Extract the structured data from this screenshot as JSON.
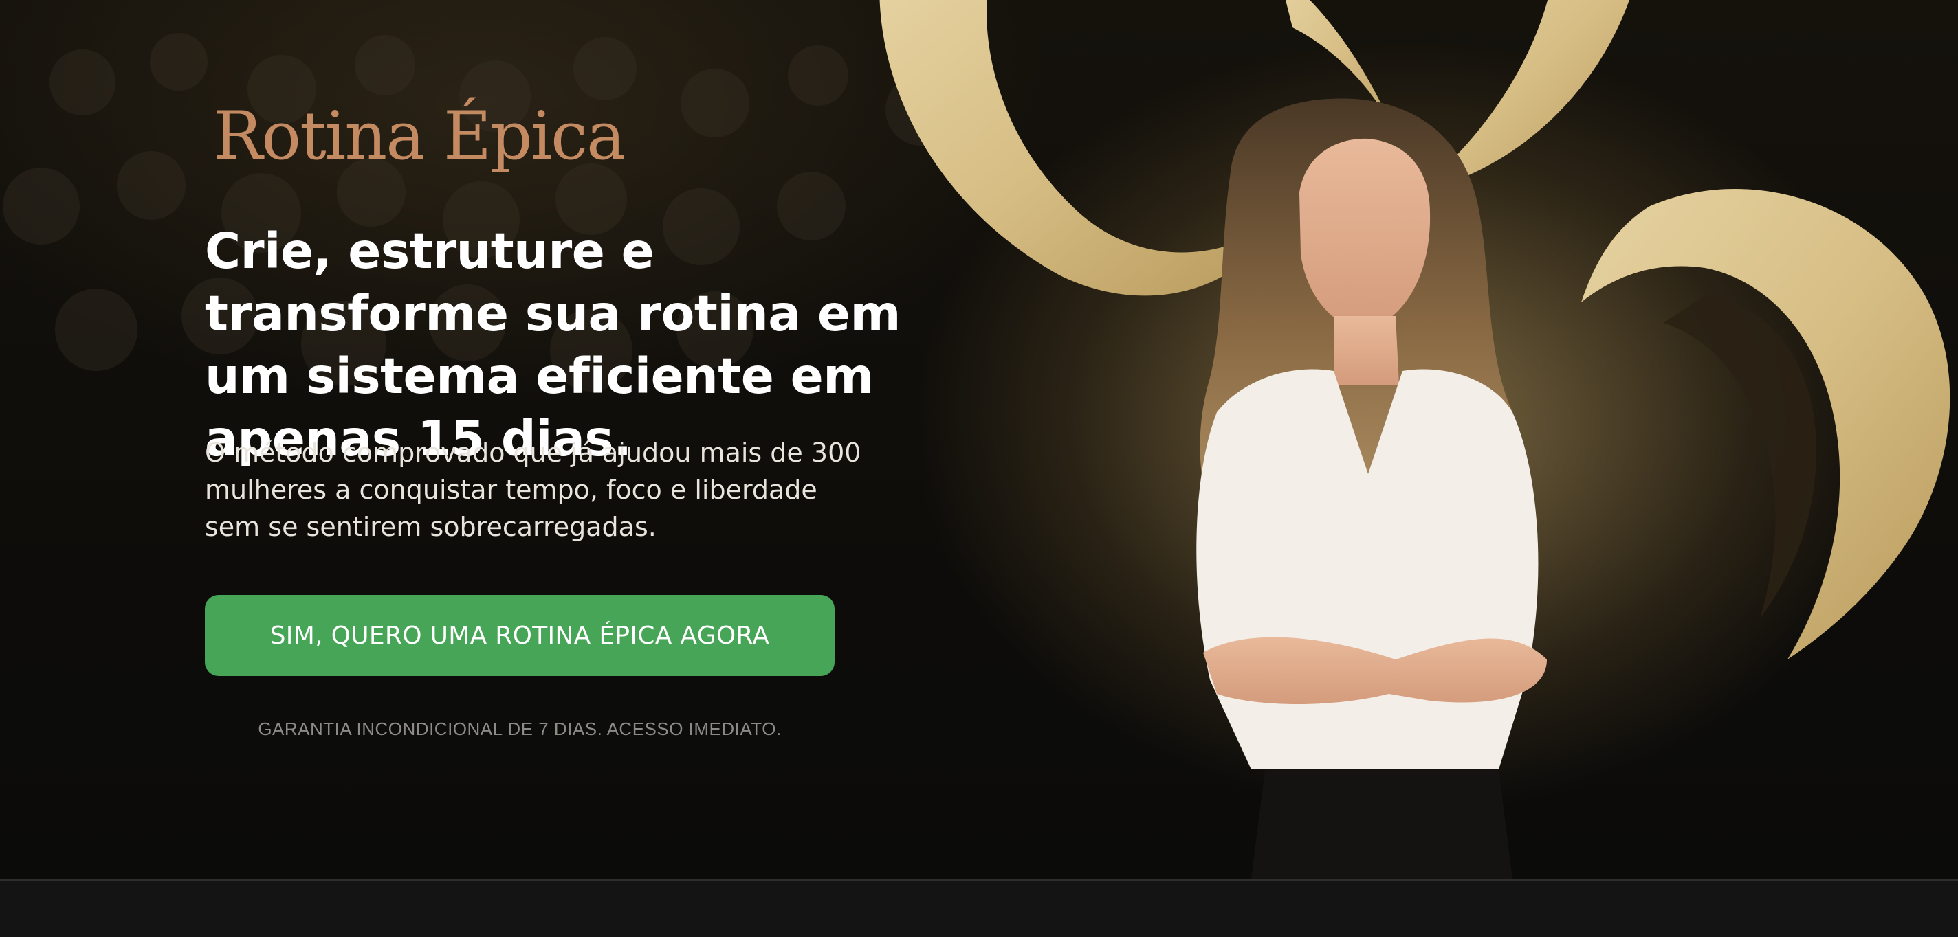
{
  "brand": {
    "logo_text": "Rotina Épica",
    "logo_color": "#c48a62"
  },
  "hero": {
    "headline": "Crie, estruture e transforme sua rotina em um sistema eficiente em apenas 15 dias.",
    "subheadline": "O método comprovado que já ajudou mais de 300 mulheres a conquistar tempo, foco e liberdade sem se sentirem sobrecarregadas.",
    "cta_label": "SIM, QUERO UMA ROTINA ÉPICA AGORA",
    "guarantee_text": "GARANTIA INCONDICIONAL DE 7 DIAS. ACESSO IMEDIATO."
  },
  "colors": {
    "cta_background": "#46a556",
    "accent_gold": "#d9c08a",
    "background": "#0b0b0a"
  },
  "images": {
    "portrait": "woman-portrait-crossed-arms",
    "decoration": "gold-swirl-shapes"
  }
}
